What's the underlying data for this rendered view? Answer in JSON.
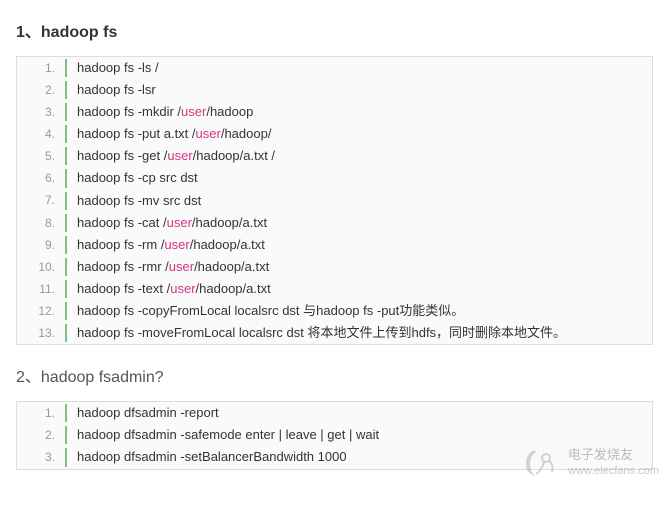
{
  "sections": [
    {
      "title": "1、hadoop fs",
      "title_class": "",
      "lines": [
        {
          "segments": [
            {
              "t": "hadoop fs -ls /"
            }
          ]
        },
        {
          "segments": [
            {
              "t": "hadoop fs -lsr"
            }
          ]
        },
        {
          "segments": [
            {
              "t": "hadoop fs -mkdir /"
            },
            {
              "t": "user",
              "c": "pink"
            },
            {
              "t": "/hadoop"
            }
          ]
        },
        {
          "segments": [
            {
              "t": "hadoop fs -put a.txt /"
            },
            {
              "t": "user",
              "c": "pink"
            },
            {
              "t": "/hadoop/"
            }
          ]
        },
        {
          "segments": [
            {
              "t": "hadoop fs -get /"
            },
            {
              "t": "user",
              "c": "pink"
            },
            {
              "t": "/hadoop/a.txt /"
            }
          ]
        },
        {
          "segments": [
            {
              "t": "hadoop fs -cp src dst"
            }
          ]
        },
        {
          "segments": [
            {
              "t": "hadoop fs -mv src dst"
            }
          ]
        },
        {
          "segments": [
            {
              "t": "hadoop fs -cat /"
            },
            {
              "t": "user",
              "c": "pink"
            },
            {
              "t": "/hadoop/a.txt"
            }
          ]
        },
        {
          "segments": [
            {
              "t": "hadoop fs -rm /"
            },
            {
              "t": "user",
              "c": "pink"
            },
            {
              "t": "/hadoop/a.txt"
            }
          ]
        },
        {
          "segments": [
            {
              "t": "hadoop fs -rmr /"
            },
            {
              "t": "user",
              "c": "pink"
            },
            {
              "t": "/hadoop/a.txt"
            }
          ]
        },
        {
          "segments": [
            {
              "t": "hadoop fs -text /"
            },
            {
              "t": "user",
              "c": "pink"
            },
            {
              "t": "/hadoop/a.txt"
            }
          ]
        },
        {
          "segments": [
            {
              "t": "hadoop fs -copyFromLocal localsrc dst 与hadoop fs -put功能类似。"
            }
          ]
        },
        {
          "segments": [
            {
              "t": "hadoop fs -moveFromLocal localsrc dst 将本地文件上传到hdfs，同时删除本地文件。"
            }
          ]
        }
      ]
    },
    {
      "title": "2、hadoop fsadmin?",
      "title_class": "secondary",
      "lines": [
        {
          "segments": [
            {
              "t": "hadoop dfsadmin -report"
            }
          ]
        },
        {
          "segments": [
            {
              "t": "hadoop dfsadmin -safemode enter | leave | get | wait"
            }
          ]
        },
        {
          "segments": [
            {
              "t": "hadoop dfsadmin -setBalancerBandwidth 1000"
            }
          ]
        }
      ]
    }
  ],
  "watermark": {
    "cn": "电子发烧友",
    "url": "www.elecfans.com"
  }
}
